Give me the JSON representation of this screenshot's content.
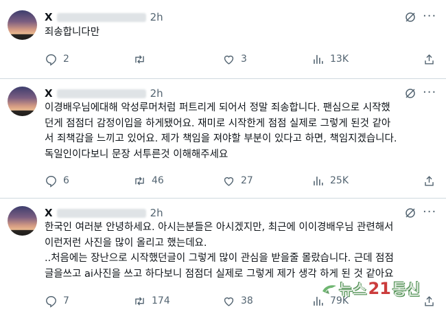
{
  "posts": [
    {
      "name": "X",
      "time": "2h",
      "text": "죄송합니다만",
      "replies": "2",
      "reposts": "",
      "likes": "3",
      "views": "13K"
    },
    {
      "name": "X",
      "time": "2h",
      "text": "이경배우님에대해 악성루머처럼 퍼트리게 되어서 정말 죄송합니다. 팬심으로 시작했\n던게 점점더 감정이입을 하게됐어요. 재미로 시작한게 점점 실제로 그렇게 된것 같아\n서 죄책감을 느끼고 있어요. 제가 책임을 져야할 부분이 있다고 하면, 책임지겠습니다.\n독일인이다보니 문장 서투른것 이해해주세요",
      "replies": "6",
      "reposts": "46",
      "likes": "27",
      "views": "25K"
    },
    {
      "name": "X",
      "time": "2h",
      "text": "한국인 여러분 안녕하세요. 아시는분들은 아시겠지만, 최근에 이이경배우님 관련해서\n이런저런 사진을 많이 올리고 했는데요.\n..처음에는 장난으로 시작했던글이 그렇게 많이 관심을 받을줄 몰랐습니다. 근데 점점\n글을쓰고 ai사진을 쓰고 하다보니 점점더 실제로 그렇게 제가 생각 하게 된 것 같아요",
      "replies": "7",
      "reposts": "174",
      "likes": "38",
      "views": "79K"
    }
  ],
  "watermark": {
    "text": "뉴스",
    "number": "21",
    "suffix": "통신"
  },
  "icons": {
    "reply": "speech-bubble-icon",
    "repost": "repost-arrows-icon",
    "like": "heart-icon",
    "views": "bar-chart-icon",
    "share": "share-upload-icon",
    "grok": "grok-slash-icon",
    "more": "ellipsis-icon"
  },
  "colors": {
    "text": "#0f1419",
    "muted": "#536471",
    "divider": "#cfd9de"
  }
}
